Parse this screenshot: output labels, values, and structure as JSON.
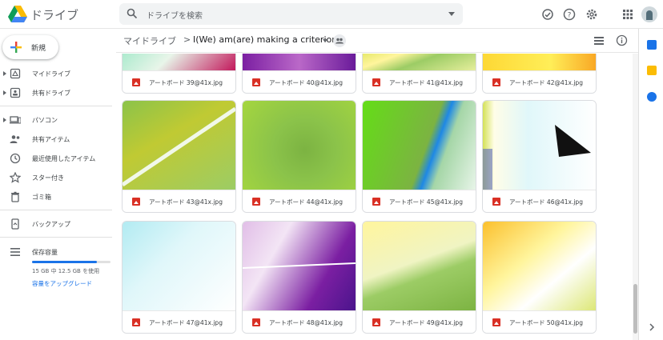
{
  "header": {
    "app_title": "ドライブ",
    "search_placeholder": "ドライブを検索"
  },
  "sidebar": {
    "new_label": "新規",
    "items": [
      {
        "label": "マイドライブ",
        "icon": "my-drive-icon"
      },
      {
        "label": "共有ドライブ",
        "icon": "shared-drives-icon"
      },
      {
        "label": "パソコン",
        "icon": "computer-icon"
      },
      {
        "label": "共有アイテム",
        "icon": "shared-with-me-icon"
      },
      {
        "label": "最近使用したアイテム",
        "icon": "recent-icon"
      },
      {
        "label": "スター付き",
        "icon": "star-icon"
      },
      {
        "label": "ゴミ箱",
        "icon": "trash-icon"
      },
      {
        "label": "バックアップ",
        "icon": "backup-icon"
      },
      {
        "label": "保存容量",
        "icon": "storage-icon"
      }
    ],
    "storage_text": "15 GB 中 12.5 GB を使用",
    "storage_fraction": 0.83,
    "upgrade_label": "容量をアップグレード"
  },
  "breadcrumb": {
    "root": "マイドライブ",
    "separator": ">",
    "current": "I(We) am(are) making a criterion"
  },
  "files": [
    {
      "name": "アートボード 39@41x.jpg"
    },
    {
      "name": "アートボード 40@41x.jpg"
    },
    {
      "name": "アートボード 41@41x.jpg"
    },
    {
      "name": "アートボード 42@41x.jpg"
    },
    {
      "name": "アートボード 43@41x.jpg"
    },
    {
      "name": "アートボード 44@41x.jpg"
    },
    {
      "name": "アートボード 45@41x.jpg"
    },
    {
      "name": "アートボード 46@41x.jpg"
    },
    {
      "name": "アートボード 47@41x.jpg"
    },
    {
      "name": "アートボード 48@41x.jpg"
    },
    {
      "name": "アートボード 49@41x.jpg"
    },
    {
      "name": "アートボード 50@41x.jpg"
    }
  ],
  "colors": {
    "accent": "#1a73e8",
    "file_icon": "#d93025"
  }
}
